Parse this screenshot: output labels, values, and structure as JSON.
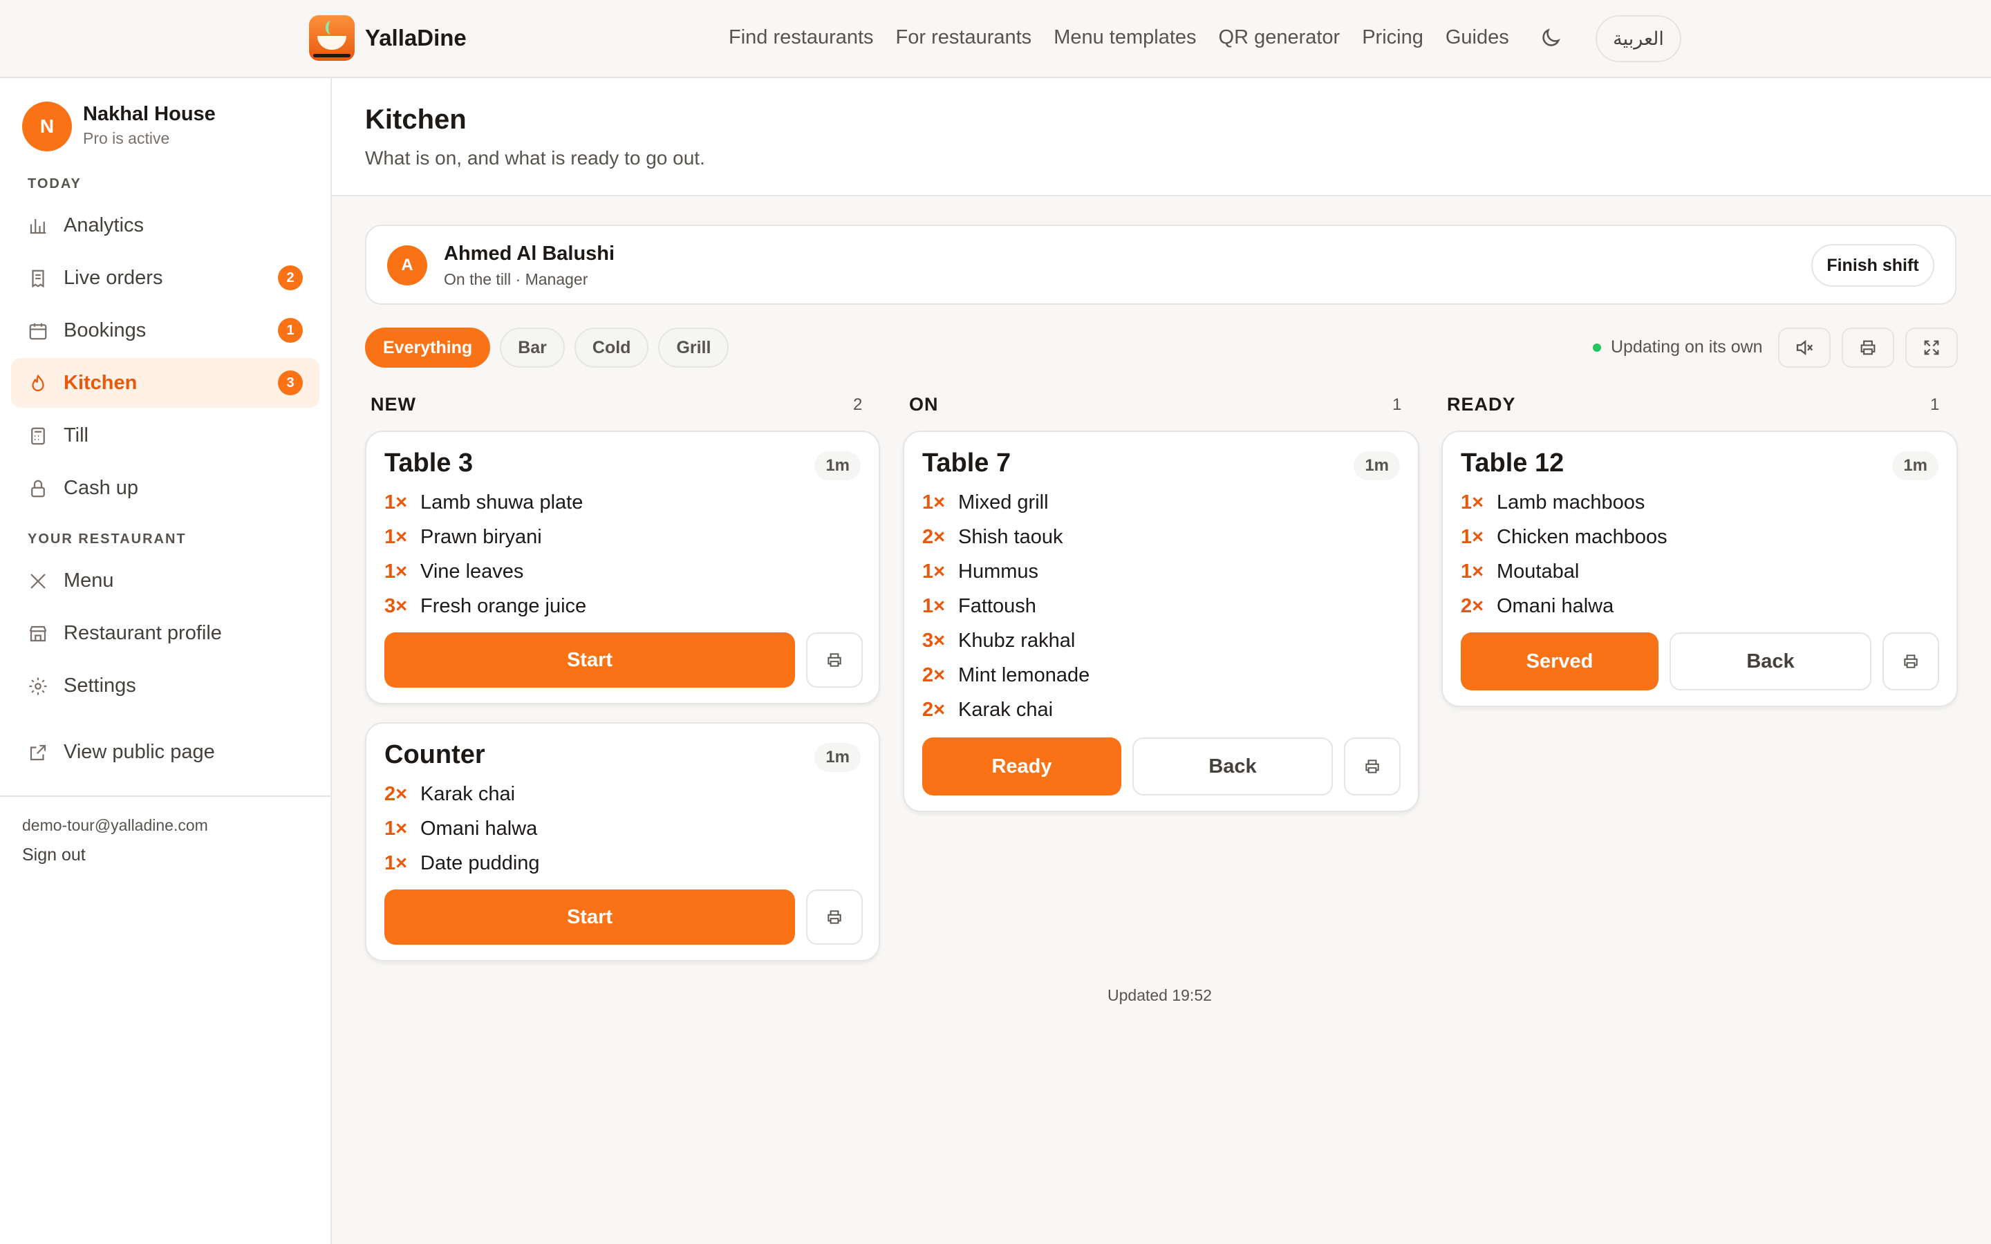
{
  "brand": "YallaDine",
  "nav": [
    "Find restaurants",
    "For restaurants",
    "Menu templates",
    "QR generator",
    "Pricing",
    "Guides"
  ],
  "language_toggle": "العربية",
  "restaurant": {
    "initial": "N",
    "name": "Nakhal House",
    "status": "Pro is active"
  },
  "sidebar": {
    "section_today": "TODAY",
    "section_restaurant": "YOUR RESTAURANT",
    "items": [
      {
        "label": "Analytics",
        "icon": "bar-chart-icon"
      },
      {
        "label": "Live orders",
        "icon": "receipt-icon",
        "badge": "2"
      },
      {
        "label": "Bookings",
        "icon": "calendar-icon",
        "badge": "1"
      },
      {
        "label": "Kitchen",
        "icon": "flame-icon",
        "badge": "3",
        "active": true
      },
      {
        "label": "Till",
        "icon": "calculator-icon"
      },
      {
        "label": "Cash up",
        "icon": "lock-icon"
      },
      {
        "label": "Menu",
        "icon": "utensils-icon"
      },
      {
        "label": "Restaurant profile",
        "icon": "store-icon"
      },
      {
        "label": "Settings",
        "icon": "gear-icon"
      },
      {
        "label": "View public page",
        "icon": "external-link-icon"
      }
    ],
    "email": "demo-tour@yalladine.com",
    "sign_out": "Sign out"
  },
  "page": {
    "title": "Kitchen",
    "subtitle": "What is on, and what is ready to go out."
  },
  "staff": {
    "initial": "A",
    "name": "Ahmed Al Balushi",
    "role": "On the till · Manager",
    "finish_label": "Finish shift"
  },
  "filters": [
    "Everything",
    "Bar",
    "Cold",
    "Grill"
  ],
  "live_status": "Updating on its own",
  "columns": {
    "new": {
      "title": "NEW",
      "count": "2",
      "orders": [
        {
          "name": "Table 3",
          "age": "1m",
          "items": [
            {
              "qty": "1×",
              "name": "Lamb shuwa plate"
            },
            {
              "qty": "1×",
              "name": "Prawn biryani"
            },
            {
              "qty": "1×",
              "name": "Vine leaves"
            },
            {
              "qty": "3×",
              "name": "Fresh orange juice"
            }
          ],
          "primary": "Start"
        },
        {
          "name": "Counter",
          "age": "1m",
          "items": [
            {
              "qty": "2×",
              "name": "Karak chai"
            },
            {
              "qty": "1×",
              "name": "Omani halwa"
            },
            {
              "qty": "1×",
              "name": "Date pudding"
            }
          ],
          "primary": "Start"
        }
      ]
    },
    "on": {
      "title": "ON",
      "count": "1",
      "orders": [
        {
          "name": "Table 7",
          "age": "1m",
          "items": [
            {
              "qty": "1×",
              "name": "Mixed grill"
            },
            {
              "qty": "2×",
              "name": "Shish taouk"
            },
            {
              "qty": "1×",
              "name": "Hummus"
            },
            {
              "qty": "1×",
              "name": "Fattoush"
            },
            {
              "qty": "3×",
              "name": "Khubz rakhal"
            },
            {
              "qty": "2×",
              "name": "Mint lemonade"
            },
            {
              "qty": "2×",
              "name": "Karak chai"
            }
          ],
          "primary": "Ready",
          "secondary": "Back"
        }
      ]
    },
    "ready": {
      "title": "READY",
      "count": "1",
      "orders": [
        {
          "name": "Table 12",
          "age": "1m",
          "items": [
            {
              "qty": "1×",
              "name": "Lamb machboos"
            },
            {
              "qty": "1×",
              "name": "Chicken machboos"
            },
            {
              "qty": "1×",
              "name": "Moutabal"
            },
            {
              "qty": "2×",
              "name": "Omani halwa"
            }
          ],
          "primary": "Served",
          "secondary": "Back"
        }
      ]
    }
  },
  "updated": "Updated 19:52",
  "colors": {
    "accent": "#f97316",
    "accent_text": "#ea580c",
    "live": "#22c55e"
  }
}
